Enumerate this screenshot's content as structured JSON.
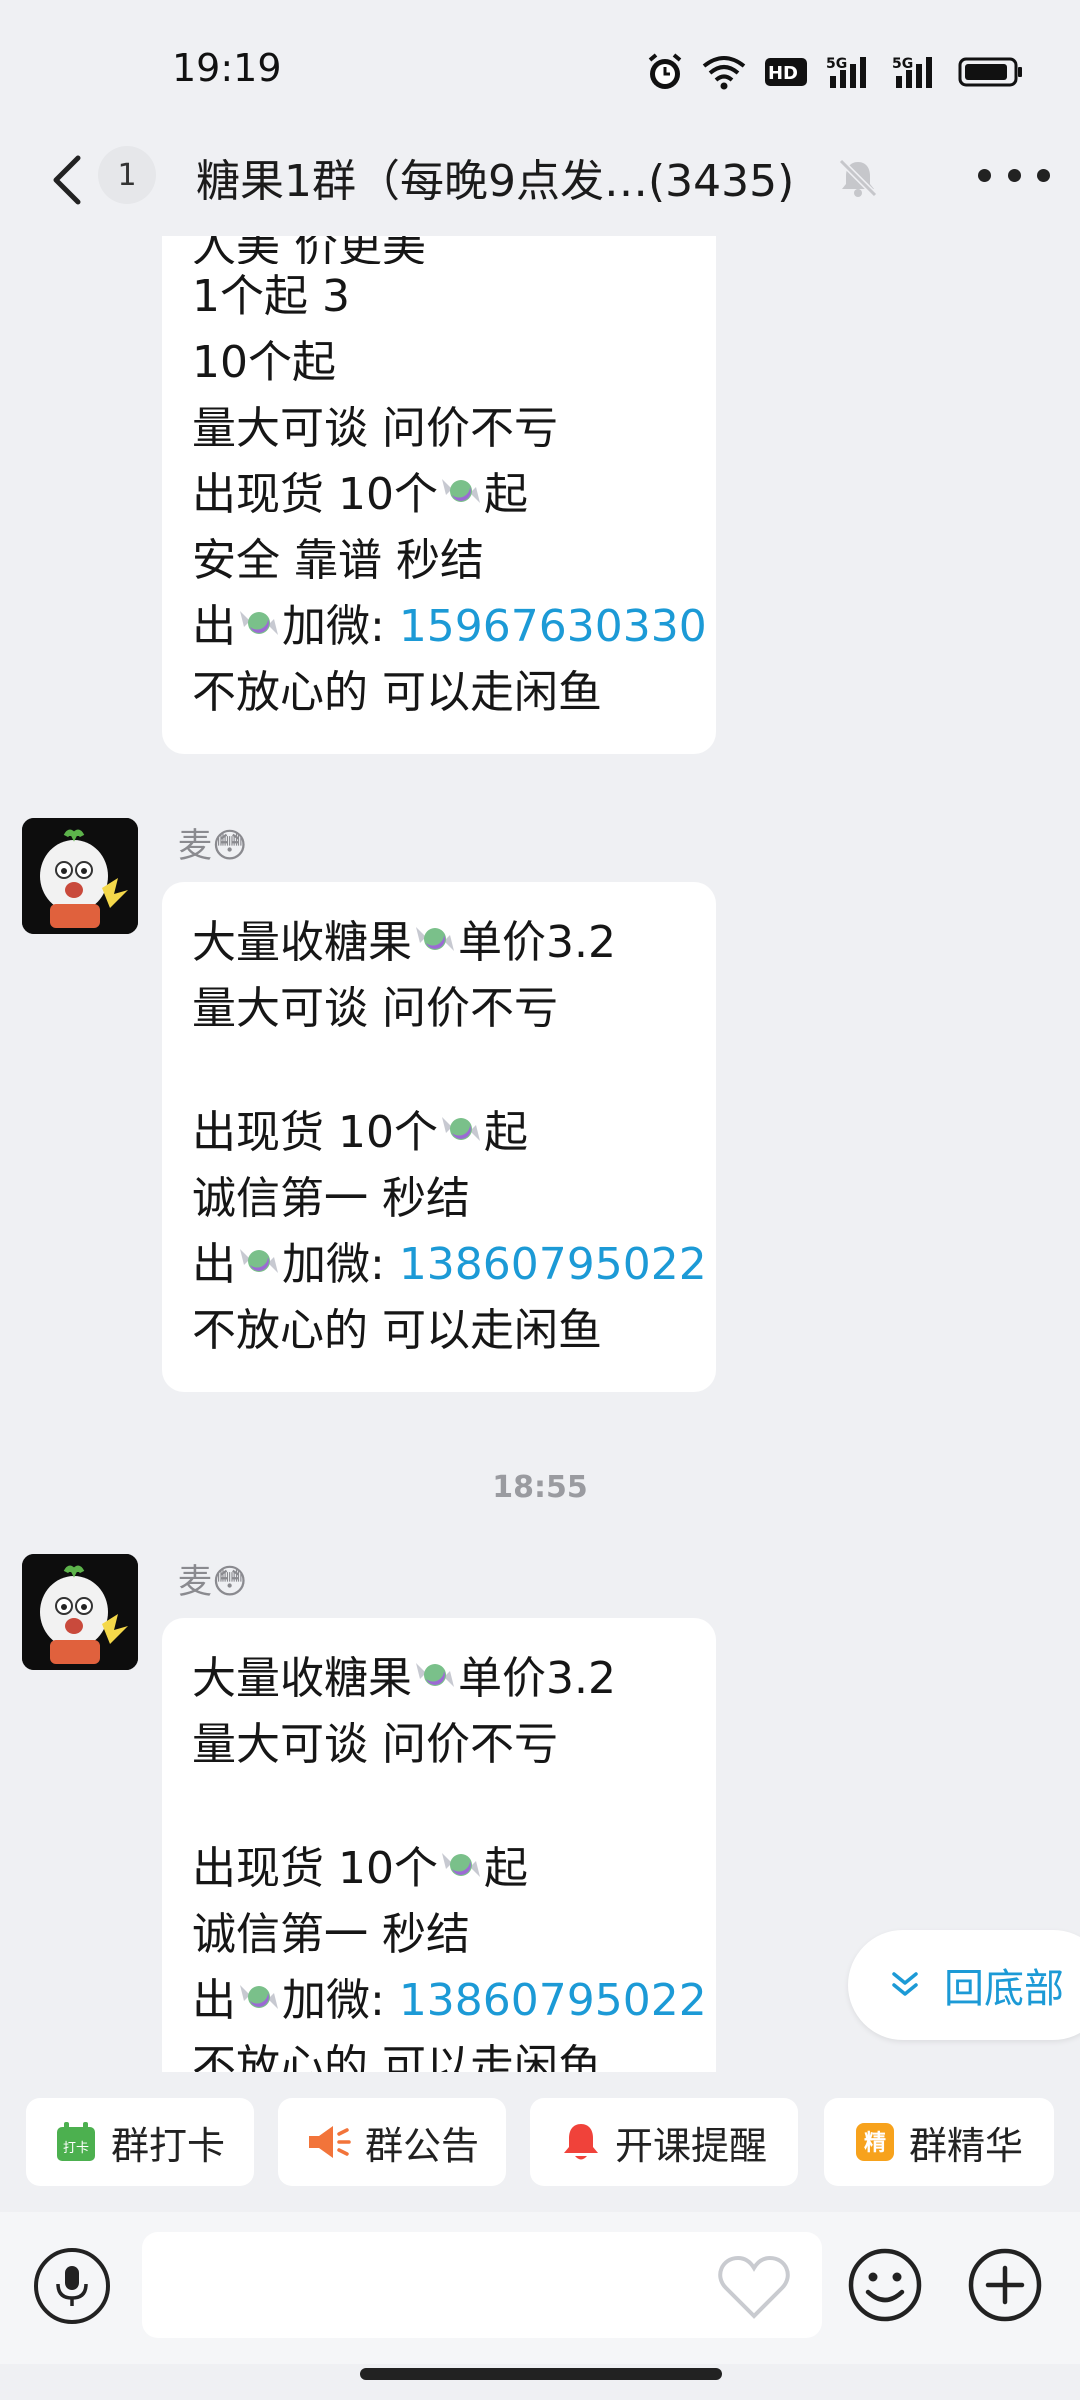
{
  "status": {
    "time": "19:19",
    "icons": [
      "alarm-icon",
      "wifi-icon",
      "hd-icon",
      "5g-signal-icon",
      "5g-signal-icon-2",
      "battery-icon"
    ],
    "hd_label": "HD",
    "g1_label": "5G",
    "g2_label": "5G"
  },
  "header": {
    "unread_count": "1",
    "title": "糖果1群（每晚9点发…(3435)",
    "icons": [
      "back-icon",
      "mute-icon",
      "more-icon"
    ]
  },
  "messages": [
    {
      "sender": "",
      "lines": [
        "人美 价更美",
        "1个起 3",
        "10个起",
        "量大可谈 问价不亏",
        "出现货 10个[candy]起",
        "安全 靠谱 秒结",
        "出[candy]加微: ",
        "不放心的 可以走闲鱼"
      ],
      "phone": "15967630330"
    },
    {
      "sender": "麦😳",
      "lines": [
        "大量收糖果[candy]单价3.2",
        "量大可谈 问价不亏",
        "",
        "出现货 10个[candy]起",
        "诚信第一 秒结",
        "出[candy]加微: ",
        "不放心的 可以走闲鱼"
      ],
      "phone": "13860795022"
    },
    {
      "timestamp": "18:55"
    },
    {
      "sender": "麦😳",
      "lines": [
        "大量收糖果[candy]单价3.2",
        "量大可谈 问价不亏",
        "",
        "出现货 10个[candy]起",
        "诚信第一 秒结",
        "出[candy]加微: ",
        "不放心的 可以走闲鱼"
      ],
      "phone": "13860795022"
    }
  ],
  "m0": {
    "l0": "人美 价更美",
    "l1": "1个起 3",
    "l2": "10个起",
    "l3": "量大可谈 问价不亏",
    "l4a": "出现货 10个",
    "l4b": "起",
    "l5": "安全 靠谱 秒结",
    "l6a": "出",
    "l6b": "加微: ",
    "phone": "15967630330",
    "l7": "不放心的 可以走闲鱼"
  },
  "m1": {
    "sender": "麦😳",
    "l0a": "大量收糖果",
    "l0b": "单价3.2",
    "l1": "量大可谈 问价不亏",
    "l3a": "出现货 10个",
    "l3b": "起",
    "l4": "诚信第一 秒结",
    "l5a": "出",
    "l5b": "加微: ",
    "phone": "13860795022",
    "l6": "不放心的 可以走闲鱼"
  },
  "ts": "18:55",
  "m2": {
    "sender": "麦😳",
    "l0a": "大量收糖果",
    "l0b": "单价3.2",
    "l1": "量大可谈 问价不亏",
    "l3a": "出现货 10个",
    "l3b": "起",
    "l4": "诚信第一 秒结",
    "l5a": "出",
    "l5b": "加微: ",
    "phone": "13860795022",
    "l6": "不放心的 可以走闲鱼"
  },
  "scroll_bottom_label": "回底部",
  "quick_actions": [
    {
      "label": "群打卡",
      "icon": "checkin-icon",
      "icon_text": "打卡",
      "color": "#4cb04f"
    },
    {
      "label": "群公告",
      "icon": "announcement-icon",
      "color": "#f2743a"
    },
    {
      "label": "开课提醒",
      "icon": "bell-icon",
      "color": "#f0423a"
    },
    {
      "label": "群精华",
      "icon": "essence-icon",
      "icon_text": "精",
      "color": "#f7a21c"
    }
  ],
  "input": {
    "placeholder": "",
    "icons": [
      "mic-icon",
      "heart-icon",
      "emoji-icon",
      "plus-icon"
    ]
  },
  "colors": {
    "background": "#eff0f3",
    "link": "#1c9ad6",
    "bubble": "#ffffff"
  }
}
